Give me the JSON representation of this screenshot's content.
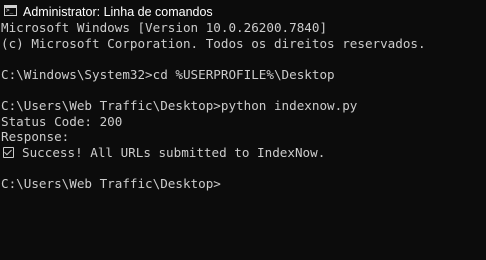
{
  "window": {
    "title": "Administrator: Linha de comandos",
    "icon": "cmd-icon"
  },
  "console": {
    "lines": [
      "Microsoft Windows [Version 10.0.26200.7840]",
      "(c) Microsoft Corporation. Todos os direitos reservados.",
      "",
      "C:\\Windows\\System32>cd %USERPROFILE%\\Desktop",
      "",
      "C:\\Users\\Web Traffic\\Desktop>python indexnow.py",
      "Status Code: 200",
      "Response:",
      "Success! All URLs submitted to IndexNow.",
      "",
      "C:\\Users\\Web Traffic\\Desktop>"
    ],
    "success_icon": "check-box-icon"
  }
}
